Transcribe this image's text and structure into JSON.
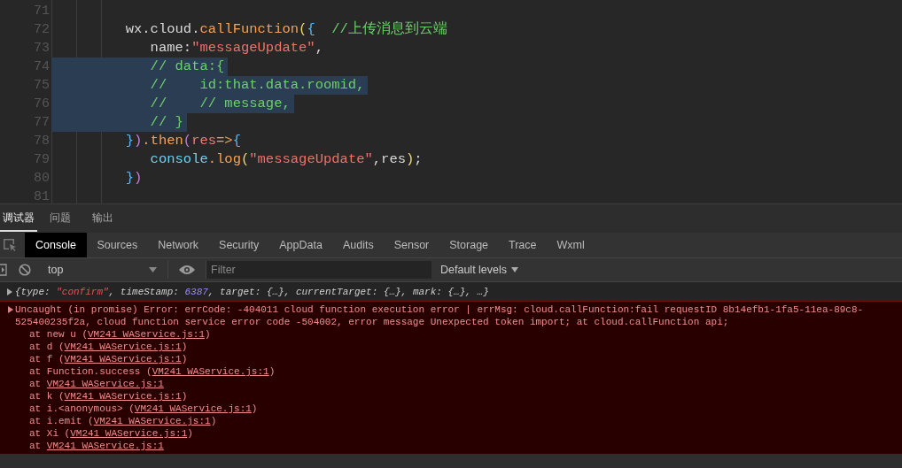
{
  "editor": {
    "lines": [
      {
        "number": "71",
        "selected": false
      },
      {
        "number": "72",
        "selected": false,
        "tokens": [
          {
            "text": "         wx.cloud.",
            "kind": "plain"
          },
          {
            "text": "callFunction",
            "kind": "method"
          },
          {
            "text": "(",
            "kind": "paren"
          },
          {
            "text": "{",
            "kind": "brace"
          },
          {
            "text": "  //上传消息到云端",
            "kind": "comment"
          }
        ]
      },
      {
        "number": "73",
        "selected": false,
        "tokens": [
          {
            "text": "            name:",
            "kind": "plain"
          },
          {
            "text": "\"messageUpdate\"",
            "kind": "string"
          },
          {
            "text": ",",
            "kind": "plain"
          }
        ]
      },
      {
        "number": "74",
        "selected": true,
        "tokens": [
          {
            "text": "            // data:{",
            "kind": "comment"
          }
        ]
      },
      {
        "number": "75",
        "selected": true,
        "tokens": [
          {
            "text": "            //    id:that.data.roomid,",
            "kind": "comment"
          }
        ]
      },
      {
        "number": "76",
        "selected": true,
        "tokens": [
          {
            "text": "            //    // message,",
            "kind": "comment"
          }
        ]
      },
      {
        "number": "77",
        "selected": true,
        "tokens": [
          {
            "text": "            // }",
            "kind": "comment"
          }
        ]
      },
      {
        "number": "78",
        "selected": false,
        "tokens": [
          {
            "text": "         }",
            "kind": "brace"
          },
          {
            "text": ")",
            "kind": "paren2"
          },
          {
            "text": ".then",
            "kind": "method"
          },
          {
            "text": "(",
            "kind": "paren2"
          },
          {
            "text": "res",
            "kind": "param"
          },
          {
            "text": "=>",
            "kind": "method"
          },
          {
            "text": "{",
            "kind": "brace"
          }
        ]
      },
      {
        "number": "79",
        "selected": false,
        "tokens": [
          {
            "text": "            console",
            "kind": "object"
          },
          {
            "text": ".log",
            "kind": "method"
          },
          {
            "text": "(",
            "kind": "paren"
          },
          {
            "text": "\"messageUpdate\"",
            "kind": "string"
          },
          {
            "text": ",res",
            "kind": "plain"
          },
          {
            "text": ")",
            "kind": "paren"
          },
          {
            "text": ";",
            "kind": "plain"
          }
        ]
      },
      {
        "number": "80",
        "selected": false,
        "tokens": [
          {
            "text": "         }",
            "kind": "brace"
          },
          {
            "text": ")",
            "kind": "paren2"
          }
        ]
      },
      {
        "number": "81",
        "selected": false
      }
    ]
  },
  "panel_tabs": [
    {
      "label": "调试器",
      "selected": true
    },
    {
      "label": "问题",
      "selected": false
    },
    {
      "label": "输出",
      "selected": false
    }
  ],
  "devtools_tabs": [
    {
      "label": "Console",
      "selected": true
    },
    {
      "label": "Sources",
      "selected": false
    },
    {
      "label": "Network",
      "selected": false
    },
    {
      "label": "Security",
      "selected": false
    },
    {
      "label": "AppData",
      "selected": false
    },
    {
      "label": "Audits",
      "selected": false
    },
    {
      "label": "Sensor",
      "selected": false
    },
    {
      "label": "Storage",
      "selected": false
    },
    {
      "label": "Trace",
      "selected": false
    },
    {
      "label": "Wxml",
      "selected": false
    }
  ],
  "toolbar": {
    "context": "top",
    "filter_placeholder": "Filter",
    "levels": "Default levels"
  },
  "console": {
    "log": [
      {
        "text": "{type: ",
        "kind": "plain"
      },
      {
        "text": "\"confirm\"",
        "kind": "string"
      },
      {
        "text": ", timeStamp: ",
        "kind": "plain"
      },
      {
        "text": "6387",
        "kind": "number"
      },
      {
        "text": ", target: {…}, currentTarget: {…}, mark: {…}, …}",
        "kind": "plain"
      }
    ],
    "error": {
      "message": "Uncaught (in promise) Error: errCode: -404011 cloud function execution error | errMsg: cloud.callFunction:fail requestID 8b14efb1-1fa5-11ea-89c8-525400235f2a, cloud function service error code -504002, error message Unexpected token import; at cloud.callFunction api;",
      "stack": [
        {
          "text": "at new u (",
          "link": "VM241 WAService.js:1",
          "suffix": ")"
        },
        {
          "text": "at d (",
          "link": "VM241 WAService.js:1",
          "suffix": ")"
        },
        {
          "text": "at f (",
          "link": "VM241 WAService.js:1",
          "suffix": ")"
        },
        {
          "text": "at Function.success (",
          "link": "VM241 WAService.js:1",
          "suffix": ")"
        },
        {
          "text": "at ",
          "link": "VM241 WAService.js:1"
        },
        {
          "text": "at k (",
          "link": "VM241 WAService.js:1",
          "suffix": ")"
        },
        {
          "text": "at i.<anonymous> (",
          "link": "VM241 WAService.js:1",
          "suffix": ")"
        },
        {
          "text": "at i.emit (",
          "link": "VM241 WAService.js:1",
          "suffix": ")"
        },
        {
          "text": "at Xi (",
          "link": "VM241 WAService.js:1",
          "suffix": ")"
        },
        {
          "text": "at ",
          "link": "VM241 WAService.js:1"
        }
      ]
    }
  }
}
